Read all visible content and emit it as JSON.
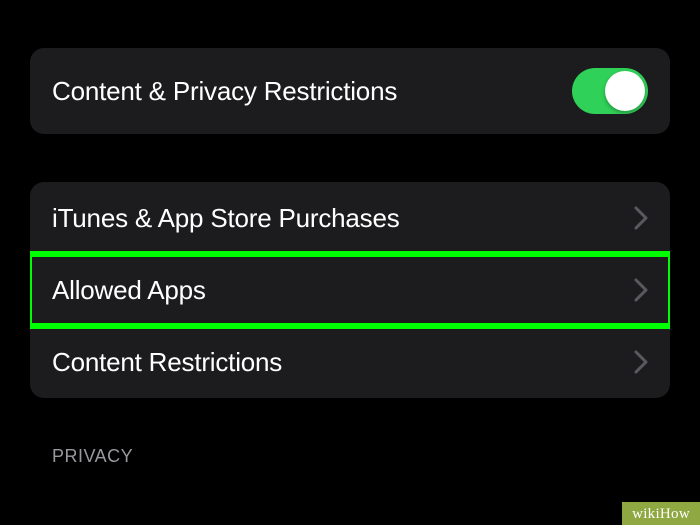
{
  "mainToggle": {
    "label": "Content & Privacy Restrictions",
    "enabled": true
  },
  "menuItems": [
    {
      "label": "iTunes & App Store Purchases",
      "highlighted": false
    },
    {
      "label": "Allowed Apps",
      "highlighted": true
    },
    {
      "label": "Content Restrictions",
      "highlighted": false
    }
  ],
  "sectionHeader": "PRIVACY",
  "watermark": "wikiHow"
}
